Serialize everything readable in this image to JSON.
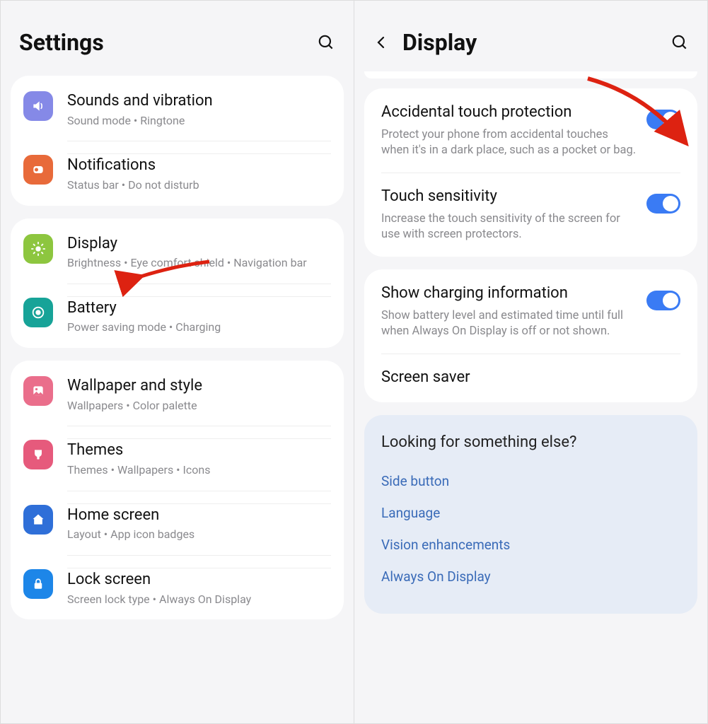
{
  "left": {
    "title": "Settings",
    "groups": [
      {
        "items": [
          {
            "icon": "sound-icon",
            "color": "ic-sound",
            "title": "Sounds and vibration",
            "sub": "Sound mode  •  Ringtone"
          },
          {
            "icon": "bell-icon",
            "color": "ic-notif",
            "title": "Notifications",
            "sub": "Status bar  •  Do not disturb"
          }
        ]
      },
      {
        "items": [
          {
            "icon": "sun-icon",
            "color": "ic-display",
            "title": "Display",
            "sub": "Brightness  •  Eye comfort shield  •  Navigation bar"
          },
          {
            "icon": "battery-icon",
            "color": "ic-battery",
            "title": "Battery",
            "sub": "Power saving mode  •  Charging"
          }
        ]
      },
      {
        "items": [
          {
            "icon": "image-icon",
            "color": "ic-wall",
            "title": "Wallpaper and style",
            "sub": "Wallpapers  •  Color palette"
          },
          {
            "icon": "brush-icon",
            "color": "ic-themes",
            "title": "Themes",
            "sub": "Themes  •  Wallpapers  •  Icons"
          },
          {
            "icon": "home-icon",
            "color": "ic-home",
            "title": "Home screen",
            "sub": "Layout  •  App icon badges"
          },
          {
            "icon": "lock-icon",
            "color": "ic-lock",
            "title": "Lock screen",
            "sub": "Screen lock type  •  Always On Display"
          }
        ]
      }
    ]
  },
  "right": {
    "title": "Display",
    "groups": [
      {
        "items": [
          {
            "title": "Accidental touch protection",
            "sub": "Protect your phone from accidental touches when it's in a dark place, such as a pocket or bag.",
            "toggle": true
          },
          {
            "title": "Touch sensitivity",
            "sub": "Increase the touch sensitivity of the screen for use with screen protectors.",
            "toggle": true
          }
        ]
      },
      {
        "items": [
          {
            "title": "Show charging information",
            "sub": "Show battery level and estimated time until full when Always On Display is off or not shown.",
            "toggle": true
          },
          {
            "title": "Screen saver",
            "sub": "",
            "toggle": false
          }
        ]
      }
    ],
    "suggest": {
      "title": "Looking for something else?",
      "links": [
        "Side button",
        "Language",
        "Vision enhancements",
        "Always On Display"
      ]
    }
  }
}
